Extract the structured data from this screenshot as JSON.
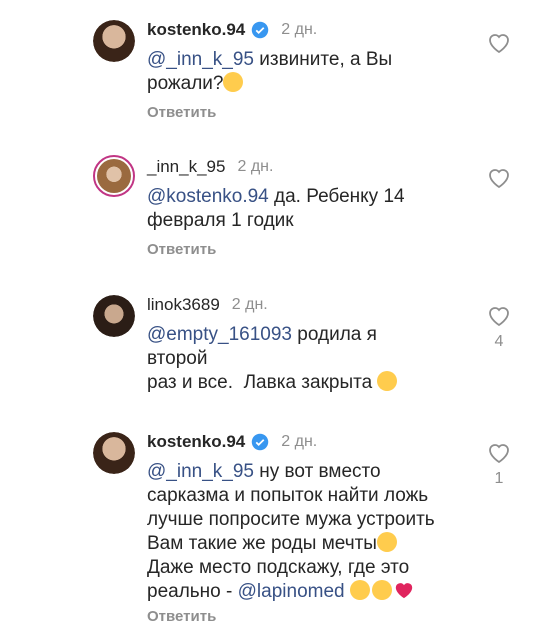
{
  "comments": [
    {
      "username": "kostenko.94",
      "verified": true,
      "time": "2 дн.",
      "mention": "@_inn_k_95",
      "text": " извините, а Вы\nрожали?",
      "emoji": "smirk",
      "reply": "Ответить",
      "likes": ""
    },
    {
      "username": "_inn_k_95",
      "verified": false,
      "time": "2 дн.",
      "mention": "@kostenko.94",
      "text": " да. Ребенку 14\nфевраля 1 годик",
      "reply": "Ответить",
      "likes": ""
    },
    {
      "username": "linok3689",
      "verified": false,
      "time": "2 дн.",
      "mention": "@empty_161093",
      "text": " родила я второй\nраз и все.  Лавка закрыта ",
      "emoji": "rofl",
      "reply": "",
      "likes": "4"
    },
    {
      "username": "kostenko.94",
      "verified": true,
      "time": "2 дн.",
      "mention": "@_inn_k_95",
      "text": " ну вот вместо\nсарказма и попыток найти ложь\nлучше попросите мужа устроить\nВам такие же роды мечты",
      "text2": "\nДаже место подскажу, где это\nреально - ",
      "mention2": "@lapinomed",
      "emoji": "blush",
      "emojis_end": [
        "heart-eyes",
        "heart-eyes",
        "red-heart"
      ],
      "reply": "Ответить",
      "likes": "1"
    }
  ],
  "colors": {
    "mention": "#385185",
    "muted": "#8e8e8e",
    "verified": "#3897f0",
    "story_ring": "#c13584"
  }
}
